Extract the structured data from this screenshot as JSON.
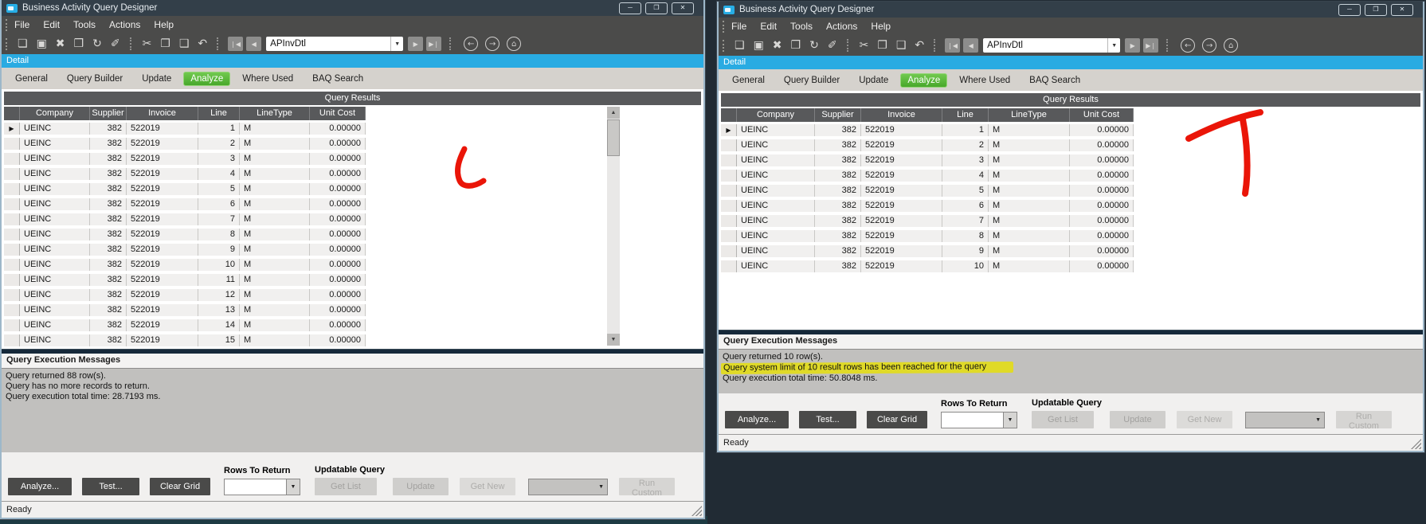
{
  "app": {
    "background_color": "#212b34",
    "annotation_red": "#ea1508",
    "detail_bar_color": "#29abe2",
    "active_tab_color": "#53b234",
    "highlight_color": "#e0da28"
  },
  "annotations": [
    {
      "name": "hand-drawn-letter-L",
      "letter": "L"
    },
    {
      "name": "hand-drawn-letter-T",
      "letter": "T"
    }
  ],
  "windows": {
    "left": {
      "title": "Business Activity Query Designer",
      "window_buttons": {
        "minimize": "─",
        "maximize": "❐",
        "close": "✕"
      },
      "menu": [
        "File",
        "Edit",
        "Tools",
        "Actions",
        "Help"
      ],
      "toolbar": {
        "group1": [
          {
            "name": "new-document-icon",
            "glyph": "❏"
          },
          {
            "name": "save-icon",
            "glyph": "▣"
          },
          {
            "name": "delete-icon",
            "glyph": "✖"
          },
          {
            "name": "paste-append-icon",
            "glyph": "❒"
          },
          {
            "name": "refresh-icon",
            "glyph": "↻"
          },
          {
            "name": "clear-icon",
            "glyph": "✐"
          }
        ],
        "group2": [
          {
            "name": "cut-icon",
            "glyph": "✂"
          },
          {
            "name": "copy-icon",
            "glyph": "❐"
          },
          {
            "name": "paste-icon",
            "glyph": "❑"
          },
          {
            "name": "undo-icon",
            "glyph": "↶"
          }
        ],
        "nav": {
          "first": "❘◀",
          "prev": "◀",
          "next": "▶",
          "last": "▶❘"
        },
        "combo_value": "APInvDtl",
        "dropdown_glyph": "▼",
        "circle": [
          {
            "name": "back-icon",
            "glyph": "←"
          },
          {
            "name": "forward-icon",
            "glyph": "→"
          },
          {
            "name": "home-icon",
            "glyph": "⌂"
          }
        ]
      },
      "detail_label": "Detail",
      "tabs": [
        {
          "label": "General",
          "active": false
        },
        {
          "label": "Query Builder",
          "active": false
        },
        {
          "label": "Update",
          "active": false
        },
        {
          "label": "Analyze",
          "active": true
        },
        {
          "label": "Where Used",
          "active": false
        },
        {
          "label": "BAQ Search",
          "active": false
        }
      ],
      "results_title": "Query Results",
      "scrollbar": {
        "up": "▲",
        "down": "▼"
      },
      "grid": {
        "columns": [
          "Company",
          "Supplier",
          "Invoice",
          "Line",
          "LineType",
          "Unit Cost"
        ],
        "rows": [
          [
            "▶",
            "UEINC",
            "382",
            "522019",
            "1",
            "M",
            "0.00000"
          ],
          [
            "",
            "UEINC",
            "382",
            "522019",
            "2",
            "M",
            "0.00000"
          ],
          [
            "",
            "UEINC",
            "382",
            "522019",
            "3",
            "M",
            "0.00000"
          ],
          [
            "",
            "UEINC",
            "382",
            "522019",
            "4",
            "M",
            "0.00000"
          ],
          [
            "",
            "UEINC",
            "382",
            "522019",
            "5",
            "M",
            "0.00000"
          ],
          [
            "",
            "UEINC",
            "382",
            "522019",
            "6",
            "M",
            "0.00000"
          ],
          [
            "",
            "UEINC",
            "382",
            "522019",
            "7",
            "M",
            "0.00000"
          ],
          [
            "",
            "UEINC",
            "382",
            "522019",
            "8",
            "M",
            "0.00000"
          ],
          [
            "",
            "UEINC",
            "382",
            "522019",
            "9",
            "M",
            "0.00000"
          ],
          [
            "",
            "UEINC",
            "382",
            "522019",
            "10",
            "M",
            "0.00000"
          ],
          [
            "",
            "UEINC",
            "382",
            "522019",
            "11",
            "M",
            "0.00000"
          ],
          [
            "",
            "UEINC",
            "382",
            "522019",
            "12",
            "M",
            "0.00000"
          ],
          [
            "",
            "UEINC",
            "382",
            "522019",
            "13",
            "M",
            "0.00000"
          ],
          [
            "",
            "UEINC",
            "382",
            "522019",
            "14",
            "M",
            "0.00000"
          ],
          [
            "",
            "UEINC",
            "382",
            "522019",
            "15",
            "M",
            "0.00000"
          ]
        ]
      },
      "messages": {
        "title": "Query Execution Messages",
        "lines": [
          {
            "text": "Query returned 88 row(s).",
            "highlight": false
          },
          {
            "text": "Query has no more records to return.",
            "highlight": false
          },
          {
            "text": "Query execution total time: 28.7193 ms.",
            "highlight": false
          }
        ]
      },
      "controls": {
        "analyze_label": "Analyze...",
        "test_label": "Test...",
        "clear_grid_label": "Clear Grid",
        "rows_to_return_label": "Rows To Return",
        "updatable_query_label": "Updatable Query",
        "get_list_label": "Get List",
        "update_label": "Update",
        "get_new_label": "Get New",
        "run_custom_label": "Run Custom"
      },
      "status": "Ready"
    },
    "right": {
      "title": "Business Activity Query Designer",
      "window_buttons": {
        "minimize": "─",
        "maximize": "❐",
        "close": "✕"
      },
      "menu": [
        "File",
        "Edit",
        "Tools",
        "Actions",
        "Help"
      ],
      "toolbar": {
        "group1": [
          {
            "name": "new-document-icon",
            "glyph": "❏"
          },
          {
            "name": "save-icon",
            "glyph": "▣"
          },
          {
            "name": "delete-icon",
            "glyph": "✖"
          },
          {
            "name": "paste-append-icon",
            "glyph": "❒"
          },
          {
            "name": "refresh-icon",
            "glyph": "↻"
          },
          {
            "name": "clear-icon",
            "glyph": "✐"
          }
        ],
        "group2": [
          {
            "name": "cut-icon",
            "glyph": "✂"
          },
          {
            "name": "copy-icon",
            "glyph": "❐"
          },
          {
            "name": "paste-icon",
            "glyph": "❑"
          },
          {
            "name": "undo-icon",
            "glyph": "↶"
          }
        ],
        "nav": {
          "first": "❘◀",
          "prev": "◀",
          "next": "▶",
          "last": "▶❘"
        },
        "combo_value": "APInvDtl",
        "dropdown_glyph": "▼",
        "circle": [
          {
            "name": "back-icon",
            "glyph": "←"
          },
          {
            "name": "forward-icon",
            "glyph": "→"
          },
          {
            "name": "home-icon",
            "glyph": "⌂"
          }
        ]
      },
      "detail_label": "Detail",
      "tabs": [
        {
          "label": "General",
          "active": false
        },
        {
          "label": "Query Builder",
          "active": false
        },
        {
          "label": "Update",
          "active": false
        },
        {
          "label": "Analyze",
          "active": true
        },
        {
          "label": "Where Used",
          "active": false
        },
        {
          "label": "BAQ Search",
          "active": false
        }
      ],
      "results_title": "Query Results",
      "scrollbar": {
        "up": "▲",
        "down": "▼"
      },
      "grid": {
        "columns": [
          "Company",
          "Supplier",
          "Invoice",
          "Line",
          "LineType",
          "Unit Cost"
        ],
        "rows": [
          [
            "▶",
            "UEINC",
            "382",
            "522019",
            "1",
            "M",
            "0.00000"
          ],
          [
            "",
            "UEINC",
            "382",
            "522019",
            "2",
            "M",
            "0.00000"
          ],
          [
            "",
            "UEINC",
            "382",
            "522019",
            "3",
            "M",
            "0.00000"
          ],
          [
            "",
            "UEINC",
            "382",
            "522019",
            "4",
            "M",
            "0.00000"
          ],
          [
            "",
            "UEINC",
            "382",
            "522019",
            "5",
            "M",
            "0.00000"
          ],
          [
            "",
            "UEINC",
            "382",
            "522019",
            "6",
            "M",
            "0.00000"
          ],
          [
            "",
            "UEINC",
            "382",
            "522019",
            "7",
            "M",
            "0.00000"
          ],
          [
            "",
            "UEINC",
            "382",
            "522019",
            "8",
            "M",
            "0.00000"
          ],
          [
            "",
            "UEINC",
            "382",
            "522019",
            "9",
            "M",
            "0.00000"
          ],
          [
            "",
            "UEINC",
            "382",
            "522019",
            "10",
            "M",
            "0.00000"
          ]
        ]
      },
      "messages": {
        "title": "Query Execution Messages",
        "lines": [
          {
            "text": "Query returned 10 row(s).",
            "highlight": false
          },
          {
            "text": "Query system limit of 10 result rows has been reached for the query",
            "highlight": true
          },
          {
            "text": "Query execution total time: 50.8048 ms.",
            "highlight": false
          }
        ]
      },
      "controls": {
        "analyze_label": "Analyze...",
        "test_label": "Test...",
        "clear_grid_label": "Clear Grid",
        "rows_to_return_label": "Rows To Return",
        "updatable_query_label": "Updatable Query",
        "get_list_label": "Get List",
        "update_label": "Update",
        "get_new_label": "Get New",
        "run_custom_label": "Run Custom"
      },
      "status": "Ready"
    }
  }
}
